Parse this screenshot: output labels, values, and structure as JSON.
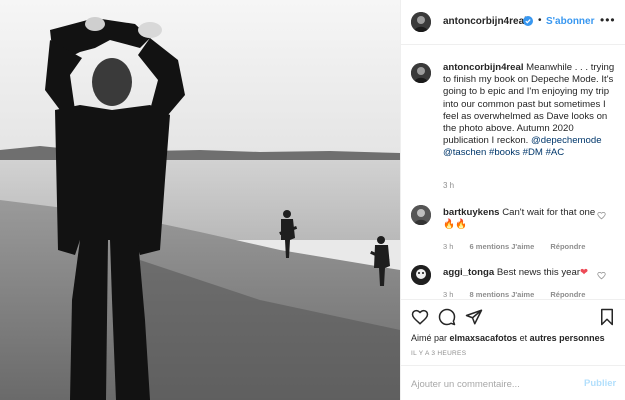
{
  "post": {
    "username": "antoncorbijn4real",
    "verified": true,
    "follow_label": "S'abonner",
    "more_icon": "more-horizontal-icon"
  },
  "photo": {
    "description_icon": "beach-photo",
    "style": "black-and-white"
  },
  "caption": {
    "username": "antoncorbijn4real",
    "text": "Meanwhile . . . trying to finish my book on Depeche Mode. It's going to b epic and I'm enjoying my trip into our common past but sometimes I feel as overwhelmed as Dave looks on the photo above. Autumn 2020 publication I reckon.",
    "tags": [
      "@depechemode",
      "@taschen",
      "#books",
      "#DM",
      "#AC"
    ],
    "time": "3 h"
  },
  "comments": [
    {
      "username": "bartkuykens",
      "text": "Can't wait for that one",
      "emoji": "🔥🔥",
      "time": "3 h",
      "likes": "6 mentions J'aime",
      "reply": "Répondre"
    },
    {
      "username": "aggi_tonga",
      "text": "Best news this year",
      "emoji": "❤",
      "time": "3 h",
      "likes": "8 mentions J'aime",
      "reply": "Répondre"
    }
  ],
  "actions": {
    "liked_by_prefix": "Aimé par",
    "liked_by_user": "elmaxsacafotos",
    "liked_by_and": "et",
    "liked_by_others": "autres personnes",
    "timestamp": "IL Y A 3 HEURES"
  },
  "add_comment": {
    "placeholder": "Ajouter un commentaire...",
    "publish_label": "Publier"
  },
  "colors": {
    "link_blue": "#3897f0",
    "tag_blue": "#00376b",
    "muted": "#8e8e8e",
    "publish_disabled": "#b2dffc",
    "heart_red": "#ed4956"
  }
}
